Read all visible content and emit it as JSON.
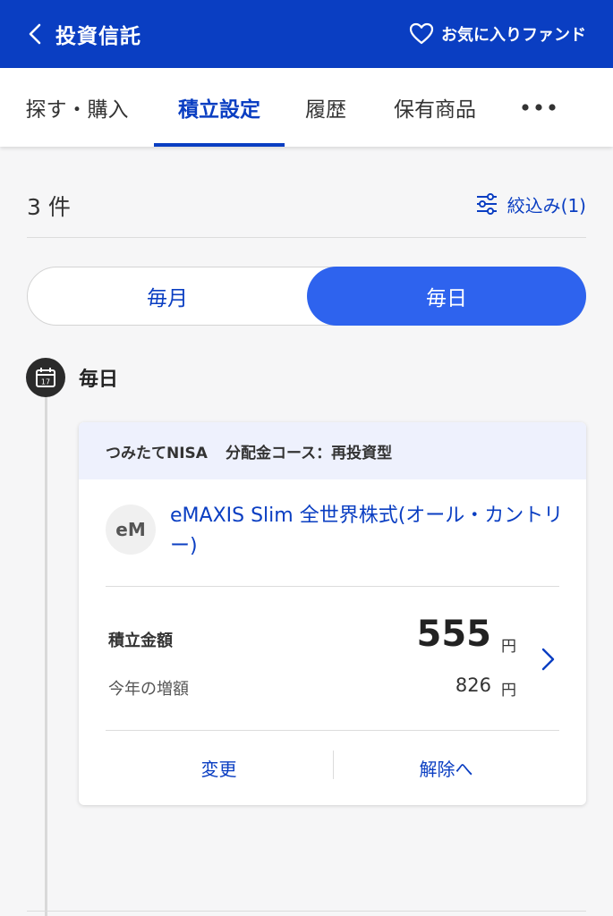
{
  "header": {
    "title": "投資信託",
    "favorites_label": "お気に入りファンド"
  },
  "tabs": [
    {
      "label": "探す・購入"
    },
    {
      "label": "積立設定",
      "active": true
    },
    {
      "label": "履歴"
    },
    {
      "label": "保有商品"
    }
  ],
  "list": {
    "count": "3 件",
    "filter_label": "絞込み(1)"
  },
  "frequency": {
    "monthly": "毎月",
    "daily": "毎日",
    "selected": "毎日"
  },
  "section": {
    "title": "毎日",
    "calendar_day": "17"
  },
  "card": {
    "account_type": "つみたてNISA",
    "course": "分配金コース：再投資型",
    "fund_initials": "eM",
    "fund_name": "eMAXIS Slim 全世界株式(オール・カントリー)",
    "amount_label": "積立金額",
    "amount_value": "555",
    "amount_unit": "円",
    "increase_label": "今年の増額",
    "increase_value": "826",
    "increase_unit": "円",
    "change_label": "変更",
    "cancel_label": "解除へ"
  },
  "colors": {
    "primary": "#0a3ec2",
    "segment_selected": "#2e63ee",
    "card_header_bg": "#eef1fd"
  }
}
